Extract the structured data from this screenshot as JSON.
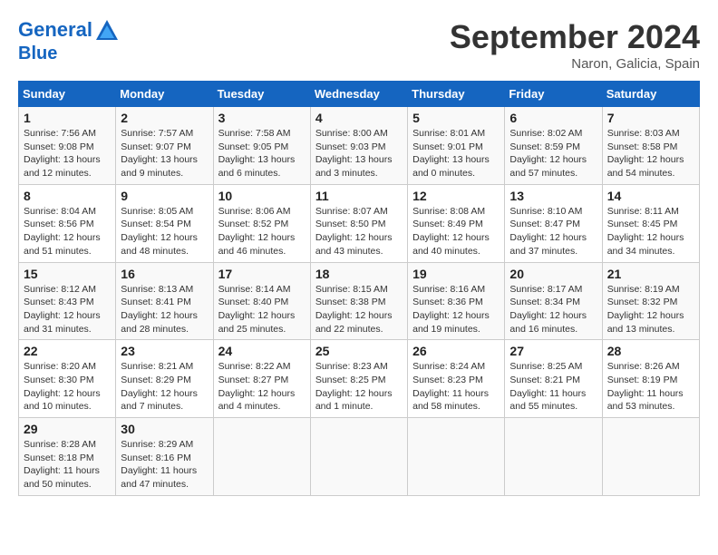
{
  "header": {
    "logo_line1": "General",
    "logo_line2": "Blue",
    "month": "September 2024",
    "location": "Naron, Galicia, Spain"
  },
  "columns": [
    "Sunday",
    "Monday",
    "Tuesday",
    "Wednesday",
    "Thursday",
    "Friday",
    "Saturday"
  ],
  "weeks": [
    [
      {
        "day": "1",
        "sunrise": "7:56 AM",
        "sunset": "9:08 PM",
        "daylight": "13 hours and 12 minutes."
      },
      {
        "day": "2",
        "sunrise": "7:57 AM",
        "sunset": "9:07 PM",
        "daylight": "13 hours and 9 minutes."
      },
      {
        "day": "3",
        "sunrise": "7:58 AM",
        "sunset": "9:05 PM",
        "daylight": "13 hours and 6 minutes."
      },
      {
        "day": "4",
        "sunrise": "8:00 AM",
        "sunset": "9:03 PM",
        "daylight": "13 hours and 3 minutes."
      },
      {
        "day": "5",
        "sunrise": "8:01 AM",
        "sunset": "9:01 PM",
        "daylight": "13 hours and 0 minutes."
      },
      {
        "day": "6",
        "sunrise": "8:02 AM",
        "sunset": "8:59 PM",
        "daylight": "12 hours and 57 minutes."
      },
      {
        "day": "7",
        "sunrise": "8:03 AM",
        "sunset": "8:58 PM",
        "daylight": "12 hours and 54 minutes."
      }
    ],
    [
      {
        "day": "8",
        "sunrise": "8:04 AM",
        "sunset": "8:56 PM",
        "daylight": "12 hours and 51 minutes."
      },
      {
        "day": "9",
        "sunrise": "8:05 AM",
        "sunset": "8:54 PM",
        "daylight": "12 hours and 48 minutes."
      },
      {
        "day": "10",
        "sunrise": "8:06 AM",
        "sunset": "8:52 PM",
        "daylight": "12 hours and 46 minutes."
      },
      {
        "day": "11",
        "sunrise": "8:07 AM",
        "sunset": "8:50 PM",
        "daylight": "12 hours and 43 minutes."
      },
      {
        "day": "12",
        "sunrise": "8:08 AM",
        "sunset": "8:49 PM",
        "daylight": "12 hours and 40 minutes."
      },
      {
        "day": "13",
        "sunrise": "8:10 AM",
        "sunset": "8:47 PM",
        "daylight": "12 hours and 37 minutes."
      },
      {
        "day": "14",
        "sunrise": "8:11 AM",
        "sunset": "8:45 PM",
        "daylight": "12 hours and 34 minutes."
      }
    ],
    [
      {
        "day": "15",
        "sunrise": "8:12 AM",
        "sunset": "8:43 PM",
        "daylight": "12 hours and 31 minutes."
      },
      {
        "day": "16",
        "sunrise": "8:13 AM",
        "sunset": "8:41 PM",
        "daylight": "12 hours and 28 minutes."
      },
      {
        "day": "17",
        "sunrise": "8:14 AM",
        "sunset": "8:40 PM",
        "daylight": "12 hours and 25 minutes."
      },
      {
        "day": "18",
        "sunrise": "8:15 AM",
        "sunset": "8:38 PM",
        "daylight": "12 hours and 22 minutes."
      },
      {
        "day": "19",
        "sunrise": "8:16 AM",
        "sunset": "8:36 PM",
        "daylight": "12 hours and 19 minutes."
      },
      {
        "day": "20",
        "sunrise": "8:17 AM",
        "sunset": "8:34 PM",
        "daylight": "12 hours and 16 minutes."
      },
      {
        "day": "21",
        "sunrise": "8:19 AM",
        "sunset": "8:32 PM",
        "daylight": "12 hours and 13 minutes."
      }
    ],
    [
      {
        "day": "22",
        "sunrise": "8:20 AM",
        "sunset": "8:30 PM",
        "daylight": "12 hours and 10 minutes."
      },
      {
        "day": "23",
        "sunrise": "8:21 AM",
        "sunset": "8:29 PM",
        "daylight": "12 hours and 7 minutes."
      },
      {
        "day": "24",
        "sunrise": "8:22 AM",
        "sunset": "8:27 PM",
        "daylight": "12 hours and 4 minutes."
      },
      {
        "day": "25",
        "sunrise": "8:23 AM",
        "sunset": "8:25 PM",
        "daylight": "12 hours and 1 minute."
      },
      {
        "day": "26",
        "sunrise": "8:24 AM",
        "sunset": "8:23 PM",
        "daylight": "11 hours and 58 minutes."
      },
      {
        "day": "27",
        "sunrise": "8:25 AM",
        "sunset": "8:21 PM",
        "daylight": "11 hours and 55 minutes."
      },
      {
        "day": "28",
        "sunrise": "8:26 AM",
        "sunset": "8:19 PM",
        "daylight": "11 hours and 53 minutes."
      }
    ],
    [
      {
        "day": "29",
        "sunrise": "8:28 AM",
        "sunset": "8:18 PM",
        "daylight": "11 hours and 50 minutes."
      },
      {
        "day": "30",
        "sunrise": "8:29 AM",
        "sunset": "8:16 PM",
        "daylight": "11 hours and 47 minutes."
      },
      null,
      null,
      null,
      null,
      null
    ]
  ]
}
